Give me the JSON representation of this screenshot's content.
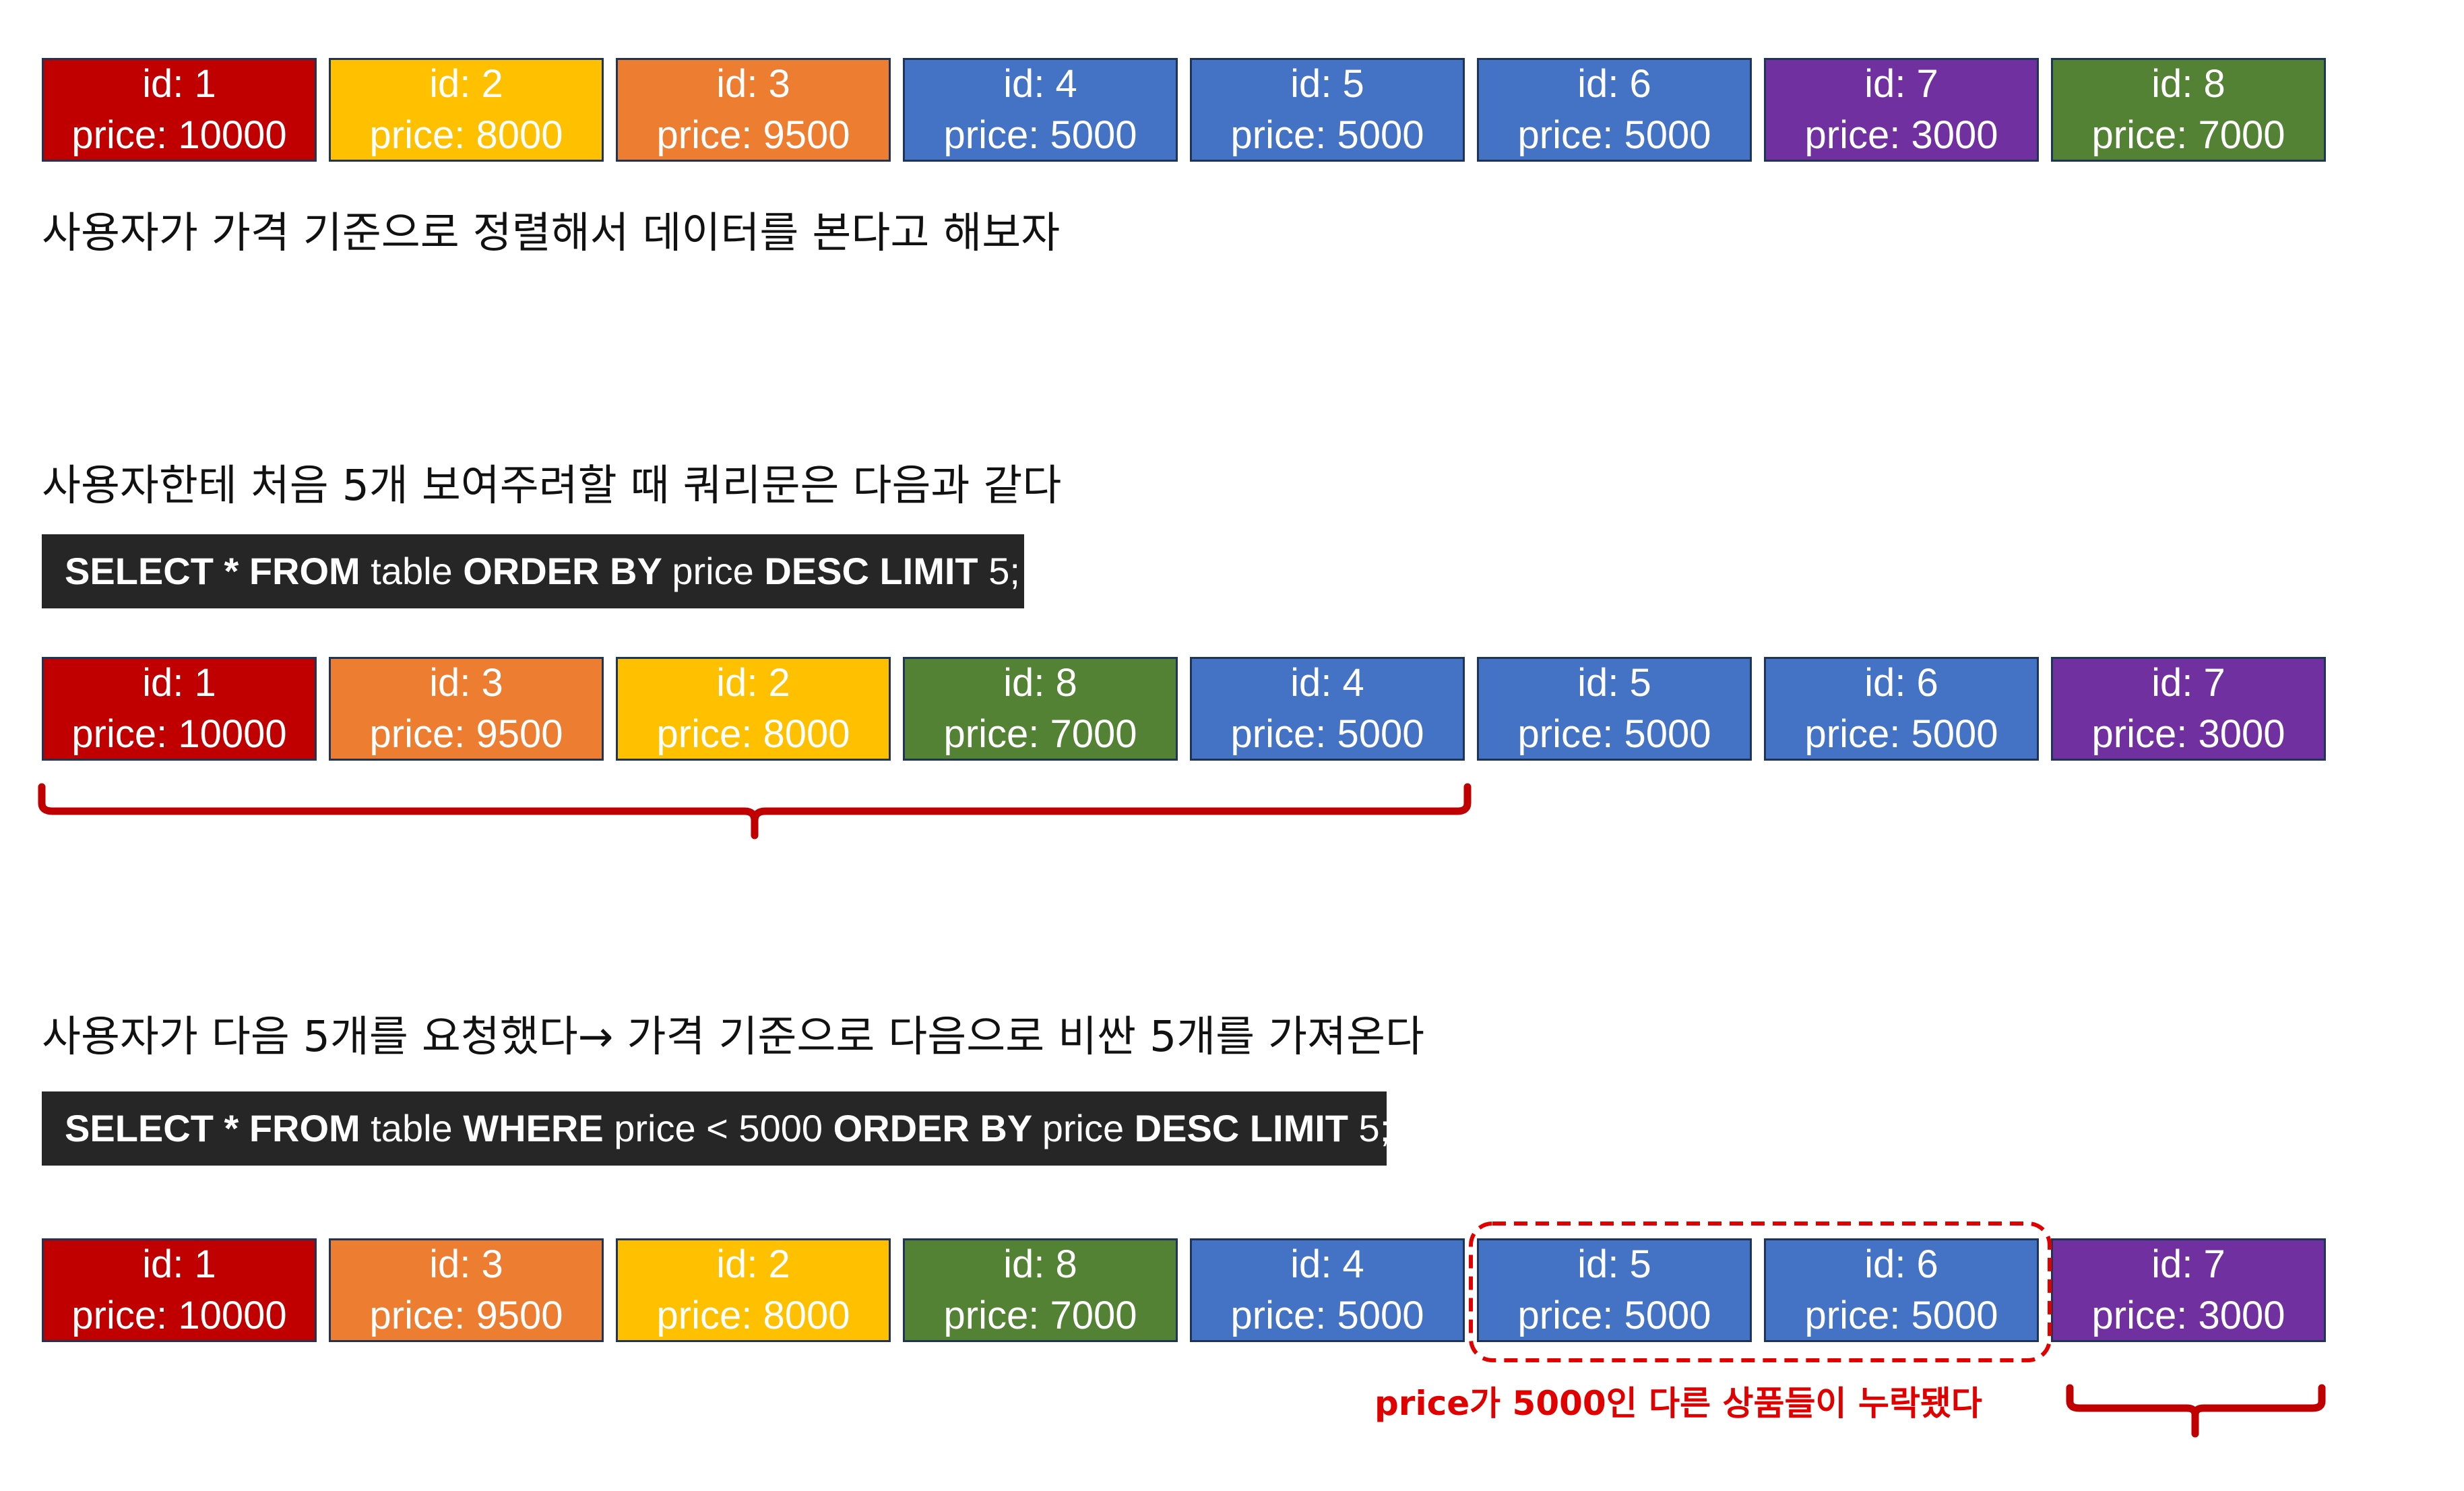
{
  "colors": {
    "red": "#c00000",
    "yellow": "#ffc000",
    "orange": "#ed7d31",
    "blue": "#4472c4",
    "purple": "#7030a0",
    "green": "#548235",
    "highlight": "#e00000",
    "sql_bg": "#262626"
  },
  "labels": {
    "id_prefix": "id: ",
    "price_prefix": "price: "
  },
  "row1": [
    {
      "id": "1",
      "price": "10000",
      "color": "red"
    },
    {
      "id": "2",
      "price": "8000",
      "color": "yellow"
    },
    {
      "id": "3",
      "price": "9500",
      "color": "orange"
    },
    {
      "id": "4",
      "price": "5000",
      "color": "blue"
    },
    {
      "id": "5",
      "price": "5000",
      "color": "blue"
    },
    {
      "id": "6",
      "price": "5000",
      "color": "blue"
    },
    {
      "id": "7",
      "price": "3000",
      "color": "purple"
    },
    {
      "id": "8",
      "price": "7000",
      "color": "green"
    }
  ],
  "caption1": "사용자가 가격 기준으로 정렬해서 데이터를 본다고 해보자",
  "caption2": "사용자한테 처음 5개 보여주려할 때 쿼리문은 다음과 같다",
  "sql1": {
    "parts": [
      {
        "t": "SELECT * FROM ",
        "bold": true
      },
      {
        "t": "table ",
        "bold": false
      },
      {
        "t": "ORDER BY ",
        "bold": true
      },
      {
        "t": "price ",
        "bold": false
      },
      {
        "t": "DESC LIMIT ",
        "bold": true
      },
      {
        "t": "5;",
        "bold": false
      }
    ]
  },
  "row2": [
    {
      "id": "1",
      "price": "10000",
      "color": "red"
    },
    {
      "id": "3",
      "price": "9500",
      "color": "orange"
    },
    {
      "id": "2",
      "price": "8000",
      "color": "yellow"
    },
    {
      "id": "8",
      "price": "7000",
      "color": "green"
    },
    {
      "id": "4",
      "price": "5000",
      "color": "blue"
    },
    {
      "id": "5",
      "price": "5000",
      "color": "blue"
    },
    {
      "id": "6",
      "price": "5000",
      "color": "blue"
    },
    {
      "id": "7",
      "price": "3000",
      "color": "purple"
    }
  ],
  "caption3": "사용자가 다음 5개를 요청했다→ 가격 기준으로 다음으로 비싼 5개를 가져온다",
  "sql2": {
    "parts": [
      {
        "t": "SELECT * FROM ",
        "bold": true
      },
      {
        "t": "table ",
        "bold": false
      },
      {
        "t": "WHERE ",
        "bold": true
      },
      {
        "t": "price < 5000 ",
        "bold": false
      },
      {
        "t": "ORDER BY ",
        "bold": true
      },
      {
        "t": "price ",
        "bold": false
      },
      {
        "t": "DESC LIMIT ",
        "bold": true
      },
      {
        "t": "5;",
        "bold": false
      }
    ]
  },
  "row3": [
    {
      "id": "1",
      "price": "10000",
      "color": "red"
    },
    {
      "id": "3",
      "price": "9500",
      "color": "orange"
    },
    {
      "id": "2",
      "price": "8000",
      "color": "yellow"
    },
    {
      "id": "8",
      "price": "7000",
      "color": "green"
    },
    {
      "id": "4",
      "price": "5000",
      "color": "blue"
    },
    {
      "id": "5",
      "price": "5000",
      "color": "blue"
    },
    {
      "id": "6",
      "price": "5000",
      "color": "blue"
    },
    {
      "id": "7",
      "price": "3000",
      "color": "purple"
    }
  ],
  "note": "price가 5000인 다른 상품들이 누락됐다"
}
